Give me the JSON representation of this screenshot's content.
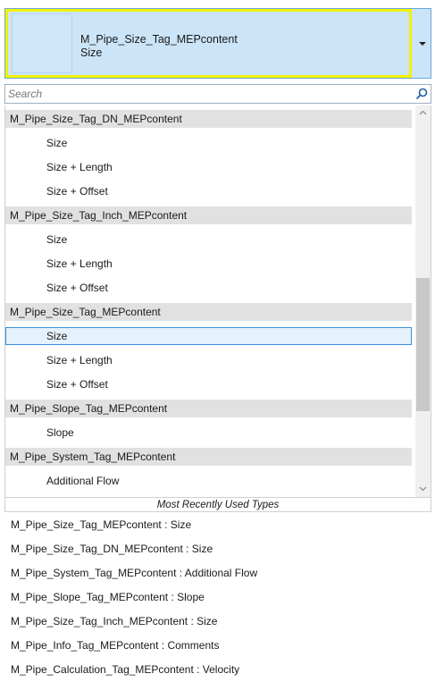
{
  "type_selector": {
    "family": "M_Pipe_Size_Tag_MEPcontent",
    "type": "Size"
  },
  "search": {
    "placeholder": "Search",
    "value": ""
  },
  "list": {
    "rows": [
      {
        "kind": "group",
        "label": "M_Pipe_Size_Tag_DN_MEPcontent"
      },
      {
        "kind": "item",
        "label": "Size"
      },
      {
        "kind": "item",
        "label": "Size + Length"
      },
      {
        "kind": "item",
        "label": "Size + Offset"
      },
      {
        "kind": "group",
        "label": "M_Pipe_Size_Tag_Inch_MEPcontent"
      },
      {
        "kind": "item",
        "label": "Size"
      },
      {
        "kind": "item",
        "label": "Size + Length"
      },
      {
        "kind": "item",
        "label": "Size + Offset"
      },
      {
        "kind": "group",
        "label": "M_Pipe_Size_Tag_MEPcontent"
      },
      {
        "kind": "item",
        "label": "Size",
        "selected": true
      },
      {
        "kind": "item",
        "label": "Size + Length"
      },
      {
        "kind": "item",
        "label": "Size + Offset"
      },
      {
        "kind": "group",
        "label": "M_Pipe_Slope_Tag_MEPcontent"
      },
      {
        "kind": "item",
        "label": "Slope"
      },
      {
        "kind": "group",
        "label": "M_Pipe_System_Tag_MEPcontent"
      },
      {
        "kind": "item",
        "label": "Additional Flow"
      }
    ]
  },
  "mru": {
    "title": "Most Recently Used Types",
    "items": [
      "M_Pipe_Size_Tag_MEPcontent : Size",
      "M_Pipe_Size_Tag_DN_MEPcontent : Size",
      "M_Pipe_System_Tag_MEPcontent : Additional Flow",
      "M_Pipe_Slope_Tag_MEPcontent : Slope",
      "M_Pipe_Size_Tag_Inch_MEPcontent : Size",
      "M_Pipe_Info_Tag_MEPcontent : Comments",
      "M_Pipe_Calculation_Tag_MEPcontent : Velocity"
    ]
  },
  "colors": {
    "header_bg": "#cce4f7",
    "highlight": "#f2f200",
    "selected_border": "#3a8ee0",
    "group_bg": "#e1e1e1"
  },
  "icons": {
    "dropdown": "chevron-down-icon",
    "search": "search-icon",
    "scroll_up": "scroll-up-arrow-icon",
    "scroll_down": "scroll-down-arrow-icon"
  }
}
